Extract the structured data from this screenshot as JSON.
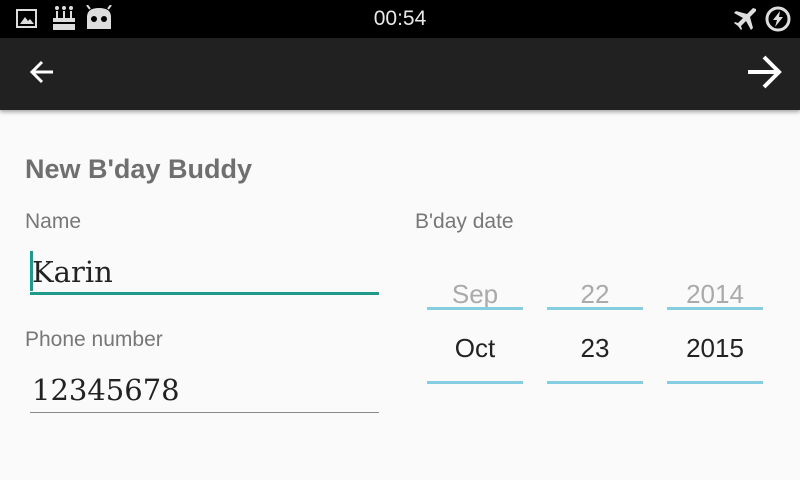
{
  "status_bar": {
    "time": "00:54",
    "left_icons": [
      "image-icon",
      "birthday-cake-icon",
      "cyanogenmod-bugdroid-icon"
    ],
    "right_icons": [
      "airplane-mode-icon",
      "battery-charging-icon"
    ]
  },
  "action_bar": {
    "back_icon": "arrow-left-icon",
    "next_icon": "arrow-right-icon"
  },
  "form": {
    "title": "New B'day Buddy",
    "name_label": "Name",
    "name_value": "Karin",
    "phone_label": "Phone number",
    "phone_value": "12345678",
    "date_label": "B'day date"
  },
  "date_picker": {
    "month": {
      "previous": "Sep",
      "current": "Oct"
    },
    "day": {
      "previous": "22",
      "current": "23"
    },
    "year": {
      "previous": "2014",
      "current": "2015"
    }
  },
  "colors": {
    "accent": "#1f9a8a",
    "picker_line": "#85cde0",
    "action_bar": "#212121"
  }
}
